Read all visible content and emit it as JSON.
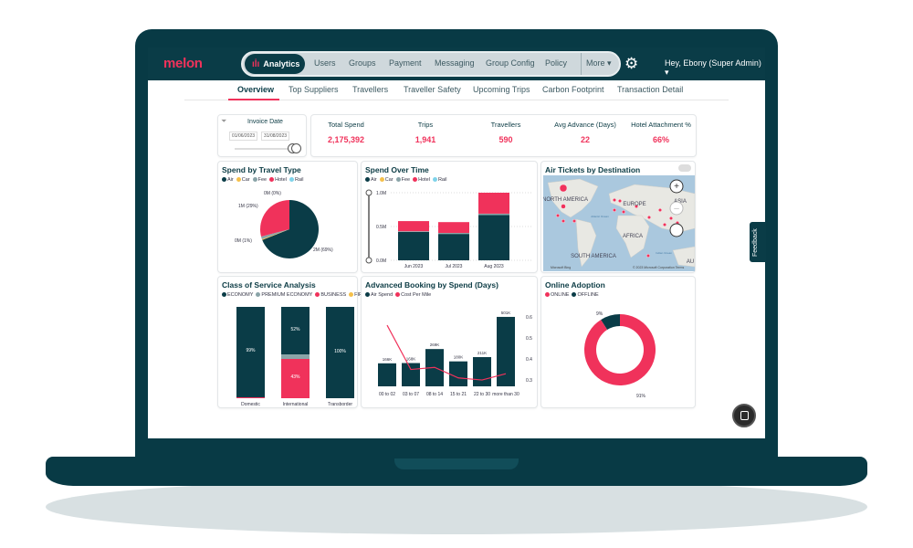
{
  "app": {
    "logo": "melon",
    "nav": {
      "active": "Analytics",
      "items": [
        "Users",
        "Groups",
        "Payment",
        "Messaging",
        "Group Config",
        "Policy"
      ],
      "more": "More ▾",
      "settings_icon": "gear-icon"
    },
    "user_menu": "Hey, Ebony (Super Admin) ▾"
  },
  "tabs": {
    "items": [
      "Overview",
      "Top Suppliers",
      "Travellers",
      "Traveller Safety",
      "Upcoming Trips",
      "Carbon Footprint",
      "Transaction Detail"
    ],
    "active": "Overview"
  },
  "filter": {
    "title": "Invoice Date",
    "start": "01/06/2023",
    "end": "31/08/2023"
  },
  "kpis": [
    {
      "label": "Total Spend",
      "value": "2,175,392"
    },
    {
      "label": "Trips",
      "value": "1,941"
    },
    {
      "label": "Travellers",
      "value": "590"
    },
    {
      "label": "Avg Advance (Days)",
      "value": "22"
    },
    {
      "label": "Hotel Attachment %",
      "value": "66%"
    }
  ],
  "colors": {
    "air": "#0a3c47",
    "car": "#f5c04a",
    "fee": "#8aa4a8",
    "hotel": "#f0325b",
    "rail": "#7fd3ea",
    "accent": "#f0325b"
  },
  "map": {
    "title": "Air Tickets by Destination",
    "labels": [
      "NORTH AMERICA",
      "EUROPE",
      "ASIA",
      "AFRICA",
      "SOUTH AMERICA",
      "Atlantic Ocean",
      "Indian Ocean",
      "AU"
    ],
    "attribution": "© 2023 Microsoft Corporation  Terms",
    "brand": "Microsoft Bing"
  },
  "feedback_label": "Feedback",
  "chart_data": [
    {
      "type": "pie",
      "title": "Spend by Travel Type",
      "legend": [
        "Air",
        "Car",
        "Fee",
        "Hotel",
        "Rail"
      ],
      "values": [
        69,
        0.5,
        1.5,
        29,
        0
      ],
      "labels": [
        "2M (69%)",
        "0M (1%)",
        "0M (1%)",
        "1M (29%)",
        "0M (0%)"
      ]
    },
    {
      "type": "bar",
      "title": "Spend Over Time",
      "legend": [
        "Air",
        "Car",
        "Fee",
        "Hotel",
        "Rail"
      ],
      "categories": [
        "Jun 2023",
        "Jul 2023",
        "Aug 2023"
      ],
      "series": [
        {
          "name": "Air",
          "values": [
            0.42,
            0.39,
            0.67
          ]
        },
        {
          "name": "Fee",
          "values": [
            0.01,
            0.015,
            0.02
          ]
        },
        {
          "name": "Hotel",
          "values": [
            0.15,
            0.16,
            0.31
          ]
        }
      ],
      "yticks": [
        "0.0M",
        "0.5M",
        "1.0M"
      ],
      "ylim": [
        0,
        1.0
      ]
    },
    {
      "type": "bar",
      "title": "Class of Service Analysis",
      "legend": [
        "ECONOMY",
        "PREMIUM ECONOMY",
        "BUSINESS",
        "FIRST"
      ],
      "categories": [
        "Domestic",
        "International",
        "Transborder"
      ],
      "series": [
        {
          "name": "ECONOMY",
          "values": [
            99,
            52,
            100
          ]
        },
        {
          "name": "PREMIUM ECONOMY",
          "values": [
            0,
            5,
            0
          ]
        },
        {
          "name": "BUSINESS",
          "values": [
            1,
            43,
            0
          ]
        },
        {
          "name": "FIRST",
          "values": [
            0,
            0,
            0
          ]
        }
      ],
      "labels": [
        [
          "99%"
        ],
        [
          "52%",
          "43%"
        ],
        [
          "100%"
        ]
      ]
    },
    {
      "type": "bar",
      "title": "Advanced Booking by Spend (Days)",
      "legend": [
        "Air Spend",
        "Cost Per Mile"
      ],
      "categories": [
        "00 to 02",
        "03 to 07",
        "08 to 14",
        "15 to 21",
        "22 to 30",
        "more than 30"
      ],
      "series": [
        {
          "name": "Air Spend",
          "values": [
            166,
            168,
            269,
            180,
            211,
            501
          ],
          "labels": [
            "166K",
            "168K",
            "269K",
            "180K",
            "211K",
            "501K"
          ]
        },
        {
          "name": "Cost Per Mile",
          "values": [
            0.56,
            0.35,
            0.36,
            0.31,
            0.3,
            0.33
          ]
        }
      ],
      "y2ticks": [
        "0.3",
        "0.4",
        "0.5",
        "0.6"
      ],
      "y2lim": [
        0.27,
        0.62
      ]
    },
    {
      "type": "pie",
      "title": "Online Adoption",
      "legend": [
        "ONLINE",
        "OFFLINE"
      ],
      "values": [
        91,
        9
      ],
      "labels": [
        "91%",
        "9%"
      ]
    }
  ]
}
